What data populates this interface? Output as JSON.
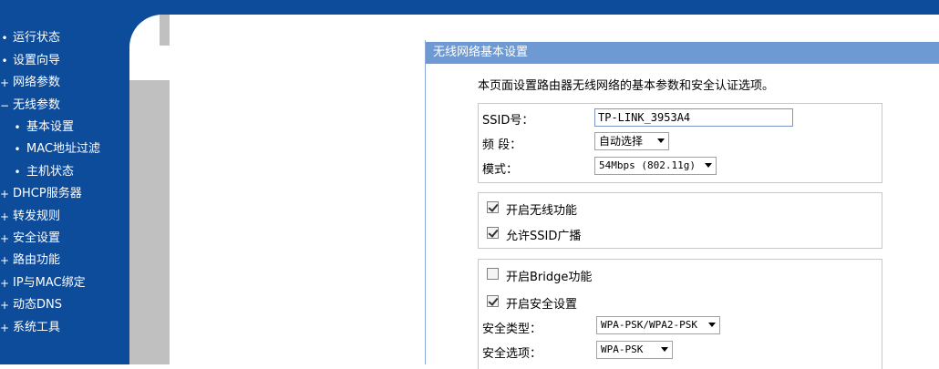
{
  "sidebar": {
    "items": [
      {
        "bullet": "•",
        "label": "运行状态"
      },
      {
        "bullet": "•",
        "label": "设置向导"
      },
      {
        "bullet": "+",
        "label": "网络参数"
      },
      {
        "bullet": "−",
        "label": "无线参数"
      },
      {
        "bullet": "•",
        "label": "基本设置"
      },
      {
        "bullet": "•",
        "label": "MAC地址过滤"
      },
      {
        "bullet": "•",
        "label": "主机状态"
      },
      {
        "bullet": "+",
        "label": "DHCP服务器"
      },
      {
        "bullet": "+",
        "label": "转发规则"
      },
      {
        "bullet": "+",
        "label": "安全设置"
      },
      {
        "bullet": "+",
        "label": "路由功能"
      },
      {
        "bullet": "+",
        "label": "IP与MAC绑定"
      },
      {
        "bullet": "+",
        "label": "动态DNS"
      },
      {
        "bullet": "+",
        "label": "系统工具"
      }
    ]
  },
  "panel": {
    "title": "无线网络基本设置",
    "description": "本页面设置路由器无线网络的基本参数和安全认证选项。"
  },
  "form": {
    "ssid_label": "SSID号：",
    "ssid_value": "TP-LINK_3953A4",
    "band_label": "频 段：",
    "band_value": "自动选择",
    "mode_label": "模式：",
    "mode_value": "54Mbps (802.11g)",
    "enable_wireless_label": "开启无线功能",
    "enable_wireless_checked": true,
    "ssid_broadcast_label": "允许SSID广播",
    "ssid_broadcast_checked": true,
    "bridge_label": "开启Bridge功能",
    "bridge_checked": false,
    "security_enable_label": "开启安全设置",
    "security_enable_checked": true,
    "security_type_label": "安全类型：",
    "security_type_value": "WPA-PSK/WPA2-PSK",
    "security_option_label": "安全选项：",
    "security_option_value": "WPA-PSK"
  },
  "colors": {
    "sidebar_bg": "#0d4b9b",
    "panel_header_bg": "#6e9ad3",
    "gray_column": "#c0c0c0"
  }
}
